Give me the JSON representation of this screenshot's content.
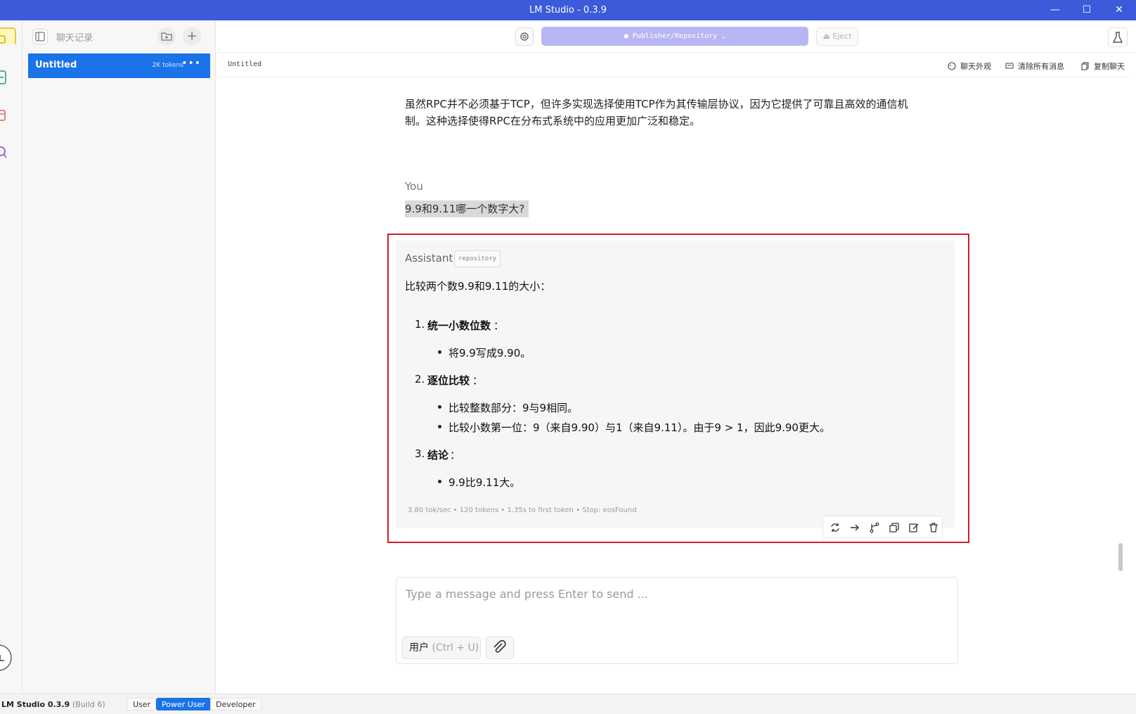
{
  "window": {
    "title": "LM Studio - 0.3.9",
    "controls": [
      "minimize",
      "maximize",
      "close"
    ]
  },
  "rail": {
    "icons": [
      "chat-icon",
      "terminal-icon",
      "folder-icon",
      "search-icon",
      "download-icon"
    ]
  },
  "sidebar": {
    "title": "聊天记录",
    "chats": [
      {
        "name": "Untitled",
        "tokens": "2K tokens",
        "more": "•••"
      }
    ]
  },
  "header": {
    "model": "Publisher/Repository",
    "eject": "Eject"
  },
  "subheader": {
    "crumb": "Untitled",
    "actions": [
      {
        "label": "聊天外观",
        "icon": "palette-icon"
      },
      {
        "label": "清除所有消息",
        "icon": "clear-messages-icon"
      },
      {
        "label": "复制聊天",
        "icon": "copy-chat-icon"
      }
    ]
  },
  "conversation": {
    "previous": "虽然RPC并不必须基于TCP，但许多实现选择使用TCP作为其传输层协议，因为它提供了可靠且高效的通信机制。这种选择使得RPC在分布式系统中的应用更加广泛和稳定。",
    "user_label": "You",
    "user_message": "9.9和9.11哪一个数字大?",
    "assistant_label": "Assistant",
    "assistant_tag": "repository",
    "answer": {
      "intro": "比较两个数9.9和9.11的大小：",
      "step1_num": "1.",
      "step1_title": "统一小数位数",
      "step1_b1": "将9.9写成9.90。",
      "step2_num": "2.",
      "step2_title": "逐位比较",
      "step2_b1": "比较整数部分：9与9相同。",
      "step2_b2": "比较小数第一位：9（来自9.90）与1（来自9.11）。由于9 > 1，因此9.90更大。",
      "step3_num": "3.",
      "step3_title": "结论",
      "step3_b1": "9.9比9.11大。",
      "colon": "："
    },
    "stats": "3.80 tok/sec • 120 tokens • 1.35s to first token • Stop: eosFound",
    "message_actions": [
      "regenerate-icon",
      "continue-arrow-icon",
      "branch-icon",
      "copy-icon",
      "edit-icon",
      "delete-icon"
    ]
  },
  "composer": {
    "placeholder": "Type a message and press Enter to send ...",
    "role": "用户",
    "role_hint": "(Ctrl + U)"
  },
  "statusbar": {
    "app": "LM Studio 0.3.9",
    "build": "(Build 6)",
    "modes": [
      "User",
      "Power User",
      "Developer"
    ],
    "active_mode": "Power User"
  },
  "colors": {
    "titlebar": "#3b5bdb",
    "accent": "#1a73e8",
    "highlight_border": "#d01e2a",
    "model_select": "#b8b6f2"
  }
}
